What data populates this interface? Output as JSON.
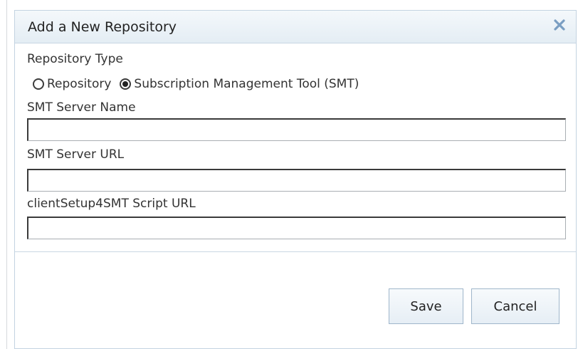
{
  "dialog": {
    "title": "Add a New Repository",
    "close_icon": "close-icon"
  },
  "form": {
    "repository_type_label": "Repository Type",
    "radio_options": [
      {
        "label": "Repository",
        "selected": false
      },
      {
        "label": "Subscription Management Tool (SMT)",
        "selected": true
      }
    ],
    "smt_server_name_label": "SMT Server Name",
    "smt_server_name_value": "",
    "smt_server_url_label": "SMT Server URL",
    "smt_server_url_value": "",
    "client_setup_script_url_label": "clientSetup4SMT Script URL",
    "client_setup_script_url_value": ""
  },
  "buttons": {
    "save_label": "Save",
    "cancel_label": "Cancel"
  },
  "colors": {
    "titlebar_background": "#e4edf4",
    "close_icon": "#7a9ec2",
    "button_border": "#9fb6cb",
    "dialog_border": "#c3d3e1"
  }
}
